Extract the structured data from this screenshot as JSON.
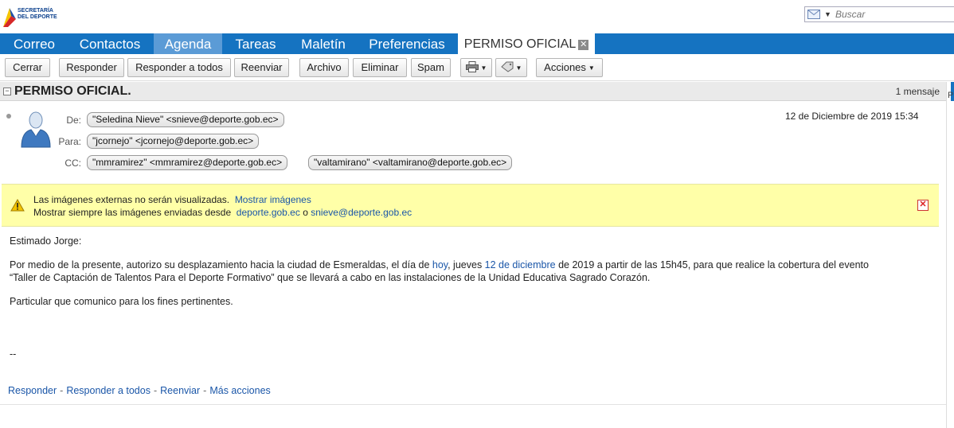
{
  "branding": {
    "logo_line1": "SECRETARÍA",
    "logo_line2": "DEL DEPORTE"
  },
  "search": {
    "placeholder": "Buscar",
    "icon": "mail-icon"
  },
  "nav": {
    "tabs": [
      {
        "label": "Correo"
      },
      {
        "label": "Contactos"
      },
      {
        "label": "Agenda"
      },
      {
        "label": "Tareas"
      },
      {
        "label": "Maletín"
      },
      {
        "label": "Preferencias"
      }
    ],
    "open_doc_tab": "PERMISO OFICIAL",
    "close_glyph": "✕"
  },
  "toolbar": {
    "close": "Cerrar",
    "reply": "Responder",
    "reply_all": "Responder a todos",
    "forward": "Reenviar",
    "archive": "Archivo",
    "delete": "Eliminar",
    "spam": "Spam",
    "actions": "Acciones"
  },
  "message": {
    "subject": "PERMISO OFICIAL.",
    "count": "1 mensaje",
    "date": "12 de Diciembre de 2019 15:34",
    "labels": {
      "from": "De:",
      "to": "Para:",
      "cc": "CC:"
    },
    "from": "\"Seledina Nieve\" <snieve@deporte.gob.ec>",
    "to": "\"jcornejo\" <jcornejo@deporte.gob.ec>",
    "cc": [
      "\"mmramirez\" <mmramirez@deporte.gob.ec>",
      "\"valtamirano\" <valtamirano@deporte.gob.ec>"
    ]
  },
  "warning": {
    "line1_text": "Las imágenes externas no serán visualizadas.",
    "line1_link": "Mostrar imágenes",
    "line2_text": "Mostrar siempre las imágenes enviadas desde",
    "line2_link1": "deporte.gob.ec",
    "line2_or": "o",
    "line2_link2": "snieve@deporte.gob.ec"
  },
  "body": {
    "greeting": "Estimado Jorge:",
    "p1_a": "Por medio de la presente, autorizo su desplazamiento hacia la ciudad de Esmeraldas, el día de ",
    "p1_link1": "hoy",
    "p1_b": ", jueves ",
    "p1_link2": "12 de diciembre",
    "p1_c": " de 2019 a partir de las 15h45, para que realice la cobertura del evento",
    "p1_line2": "“Taller de Captación de Talentos Para el Deporte Formativo” que se llevará a cabo en las instalaciones de la Unidad Educativa Sagrado Corazón.",
    "p2": "Particular que comunico para los fines pertinentes.",
    "signature": "--"
  },
  "footer": {
    "reply": "Responder",
    "reply_all": "Responder a todos",
    "forward": "Reenviar",
    "more": "Más acciones",
    "sep": "-"
  },
  "right_rail": {
    "label": "P"
  },
  "colors": {
    "nav": "#1573c1",
    "nav_active": "#5b9bd6",
    "warning_bg": "#ffffa8",
    "link": "#1a56a8"
  }
}
